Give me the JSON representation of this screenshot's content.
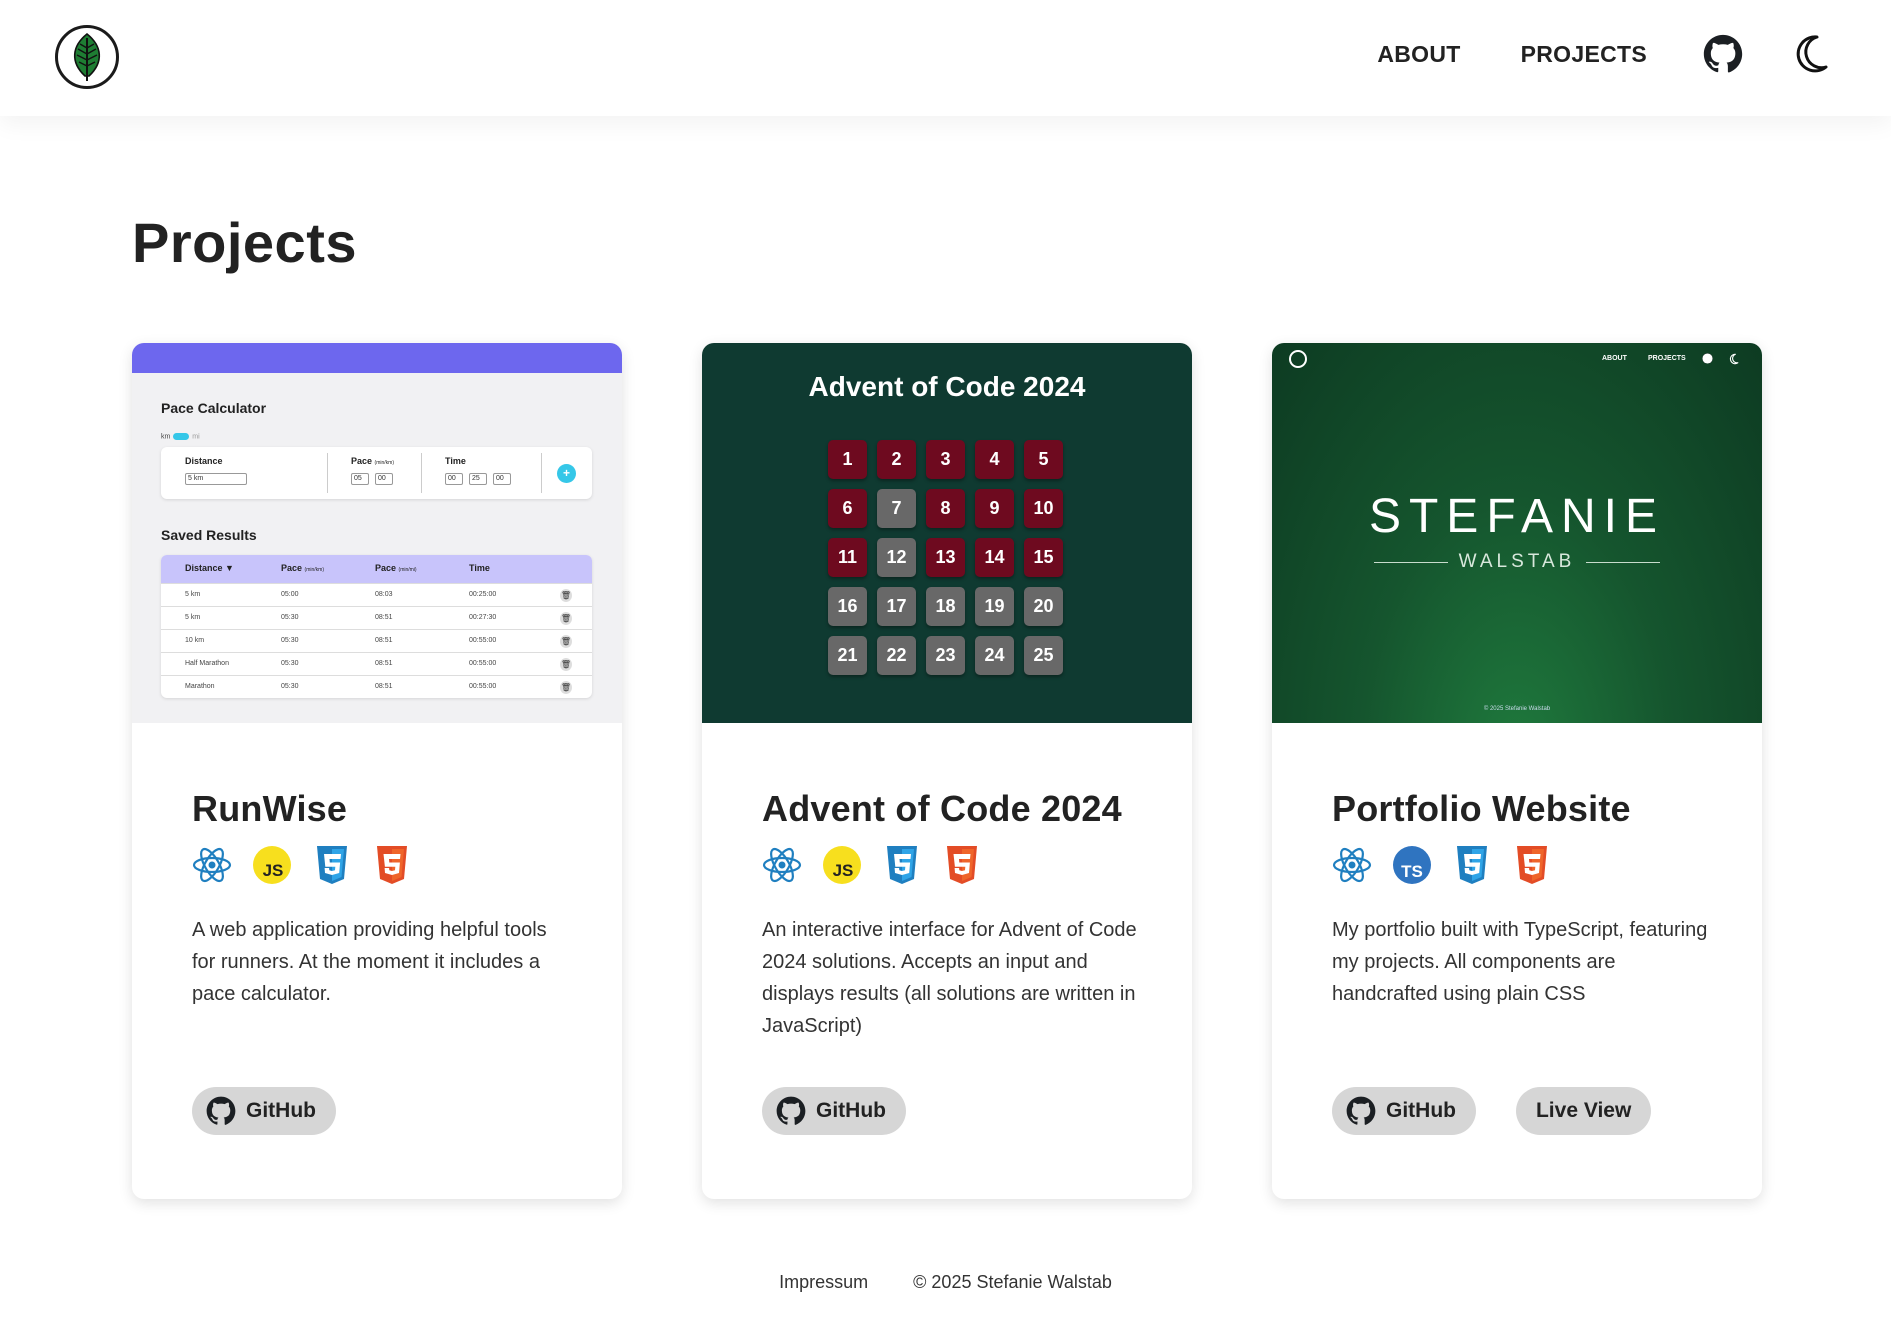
{
  "header": {
    "nav_about": "ABOUT",
    "nav_projects": "PROJECTS"
  },
  "page_title": "Projects",
  "projects": [
    {
      "title": "RunWise",
      "tech": [
        "react-icon",
        "javascript-icon",
        "css3-icon",
        "html5-icon"
      ],
      "description": "A web application providing helpful tools for runners. At the moment it includes a pace calculator.",
      "buttons": [
        "GitHub"
      ],
      "preview": {
        "title": "Pace Calculator",
        "toggle_km": "km",
        "toggle_mi": "mi",
        "fields": {
          "distance_label": "Distance",
          "distance_value": "5 km",
          "pace_label": "Pace",
          "pace_unit": "(min/km)",
          "pace_min": "05",
          "pace_sec": "00",
          "time_label": "Time",
          "time_h": "00",
          "time_m": "25",
          "time_s": "00"
        },
        "saved_title": "Saved Results",
        "table_headers": [
          "Distance ▼",
          "Pace",
          "Pace",
          "Time"
        ],
        "pace_units": [
          "(min/km)",
          "(min/mi)"
        ],
        "rows": [
          [
            "5 km",
            "05:00",
            "08:03",
            "00:25:00"
          ],
          [
            "5 km",
            "05:30",
            "08:51",
            "00:27:30"
          ],
          [
            "10 km",
            "05:30",
            "08:51",
            "00:55:00"
          ],
          [
            "Half Marathon",
            "05:30",
            "08:51",
            "00:55:00"
          ],
          [
            "Marathon",
            "05:30",
            "08:51",
            "00:55:00"
          ]
        ]
      }
    },
    {
      "title": "Advent of Code 2024",
      "tech": [
        "react-icon",
        "javascript-icon",
        "css3-icon",
        "html5-icon"
      ],
      "description": "An interactive interface for Advent of Code 2024 solutions. Accepts an input and displays results (all solutions are written in JavaScript)",
      "buttons": [
        "GitHub"
      ],
      "preview": {
        "title": "Advent of Code 2024",
        "days": [
          "1",
          "2",
          "3",
          "4",
          "5",
          "6",
          "7",
          "8",
          "9",
          "10",
          "11",
          "12",
          "13",
          "14",
          "15",
          "16",
          "17",
          "18",
          "19",
          "20",
          "21",
          "22",
          "23",
          "24",
          "25"
        ],
        "solved": [
          true,
          true,
          true,
          true,
          true,
          true,
          false,
          true,
          true,
          true,
          true,
          false,
          true,
          true,
          true,
          false,
          false,
          false,
          false,
          false,
          false,
          false,
          false,
          false,
          false
        ]
      }
    },
    {
      "title": "Portfolio Website",
      "tech": [
        "react-icon",
        "typescript-icon",
        "css3-icon",
        "html5-icon"
      ],
      "description": "My portfolio built with TypeScript, featuring my projects. All components are handcrafted using plain CSS",
      "buttons": [
        "GitHub",
        "Live View"
      ],
      "preview": {
        "nav_about": "ABOUT",
        "nav_projects": "PROJECTS",
        "name": "STEFANIE",
        "surname": "WALSTAB",
        "copyright": "© 2025 Stefanie Walstab"
      }
    }
  ],
  "footer": {
    "impressum": "Impressum",
    "copyright": "© 2025 Stefanie Walstab"
  },
  "colors": {
    "accent": "#6d67ee",
    "advent_bg": "#0f3a31",
    "advent_solved": "#6e0a1f",
    "advent_unsolved": "#686868",
    "portfolio_bg": "#15552e",
    "button_bg": "#d6d6d6"
  }
}
